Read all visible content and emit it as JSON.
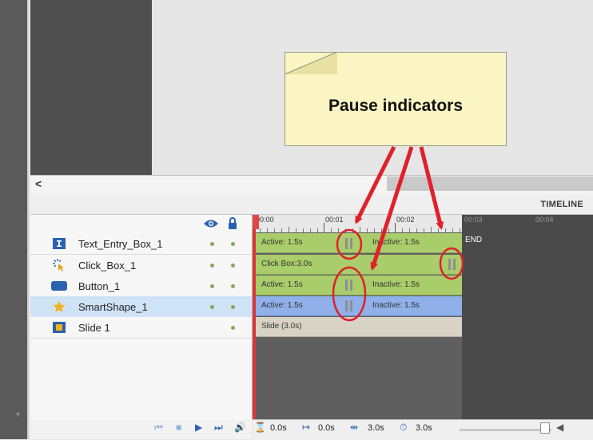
{
  "timeline": {
    "title": "TIMELINE",
    "collapse_glyph": "<",
    "ruler_ticks": [
      "00:00",
      "00:01",
      "00:02",
      "00:03",
      "00:04"
    ],
    "end_label": "END"
  },
  "layers": [
    {
      "name": "Text_Entry_Box_1",
      "icon": "text-entry-box-icon",
      "bars": [
        {
          "label": "Active: 1.5s"
        },
        {
          "label": "Inactive: 1.5s"
        }
      ]
    },
    {
      "name": "Click_Box_1",
      "icon": "click-box-icon",
      "bars": [
        {
          "label": "Click Box:3.0s"
        }
      ]
    },
    {
      "name": "Button_1",
      "icon": "button-icon",
      "bars": [
        {
          "label": "Active: 1.5s"
        },
        {
          "label": "Inactive: 1.5s"
        }
      ]
    },
    {
      "name": "SmartShape_1",
      "icon": "star-icon",
      "selected": true,
      "bars": [
        {
          "label": "Active: 1.5s"
        },
        {
          "label": "Inactive: 1.5s"
        }
      ]
    },
    {
      "name": "Slide 1",
      "icon": "slide-icon",
      "bars": [
        {
          "label": "Slide (3.0s)"
        }
      ]
    }
  ],
  "toolbar": {
    "current_time": "0.0s",
    "start_time": "0.0s",
    "duration": "3.0s",
    "timer": "3.0s"
  },
  "callout": {
    "text": "Pause indicators"
  },
  "colors": {
    "active_bar": "#a9cd6a",
    "selected_bar": "#8fb0e8",
    "slide_bar": "#d8d3c5",
    "callout_bg": "#fbf5c3",
    "annotation_red": "#e0202a",
    "playhead": "#d93636"
  }
}
